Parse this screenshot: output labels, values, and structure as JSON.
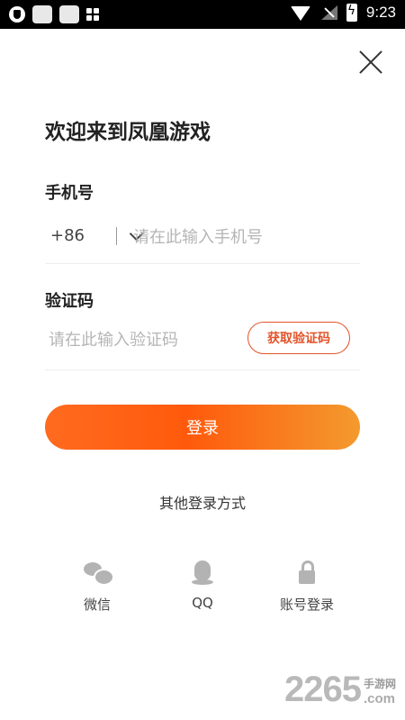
{
  "status_bar": {
    "time": "9:23",
    "icons": [
      "shield-icon",
      "app-icon",
      "app-icon",
      "grid-icon",
      "wifi-icon",
      "signal-icon",
      "battery-charging-icon"
    ]
  },
  "header": {
    "close_icon": "close-icon",
    "title": "欢迎来到凤凰游戏"
  },
  "phone": {
    "label": "手机号",
    "country_code": "+86",
    "placeholder": "请在此输入手机号"
  },
  "code": {
    "label": "验证码",
    "placeholder": "请在此输入验证码",
    "get_code_label": "获取验证码"
  },
  "login": {
    "label": "登录"
  },
  "other_login": {
    "title": "其他登录方式",
    "options": [
      {
        "label": "微信",
        "icon": "wechat-icon"
      },
      {
        "label": "QQ",
        "icon": "qq-icon"
      },
      {
        "label": "账号登录",
        "icon": "lock-icon"
      }
    ]
  },
  "watermark": {
    "number": "2265",
    "site_cn": "手游网",
    "site_com": ".com"
  },
  "colors": {
    "accent": "#e2542a",
    "button_gradient_start": "#ff6b1f",
    "button_gradient_end": "#f39a2e",
    "icon_gray": "#b3b3b3"
  }
}
